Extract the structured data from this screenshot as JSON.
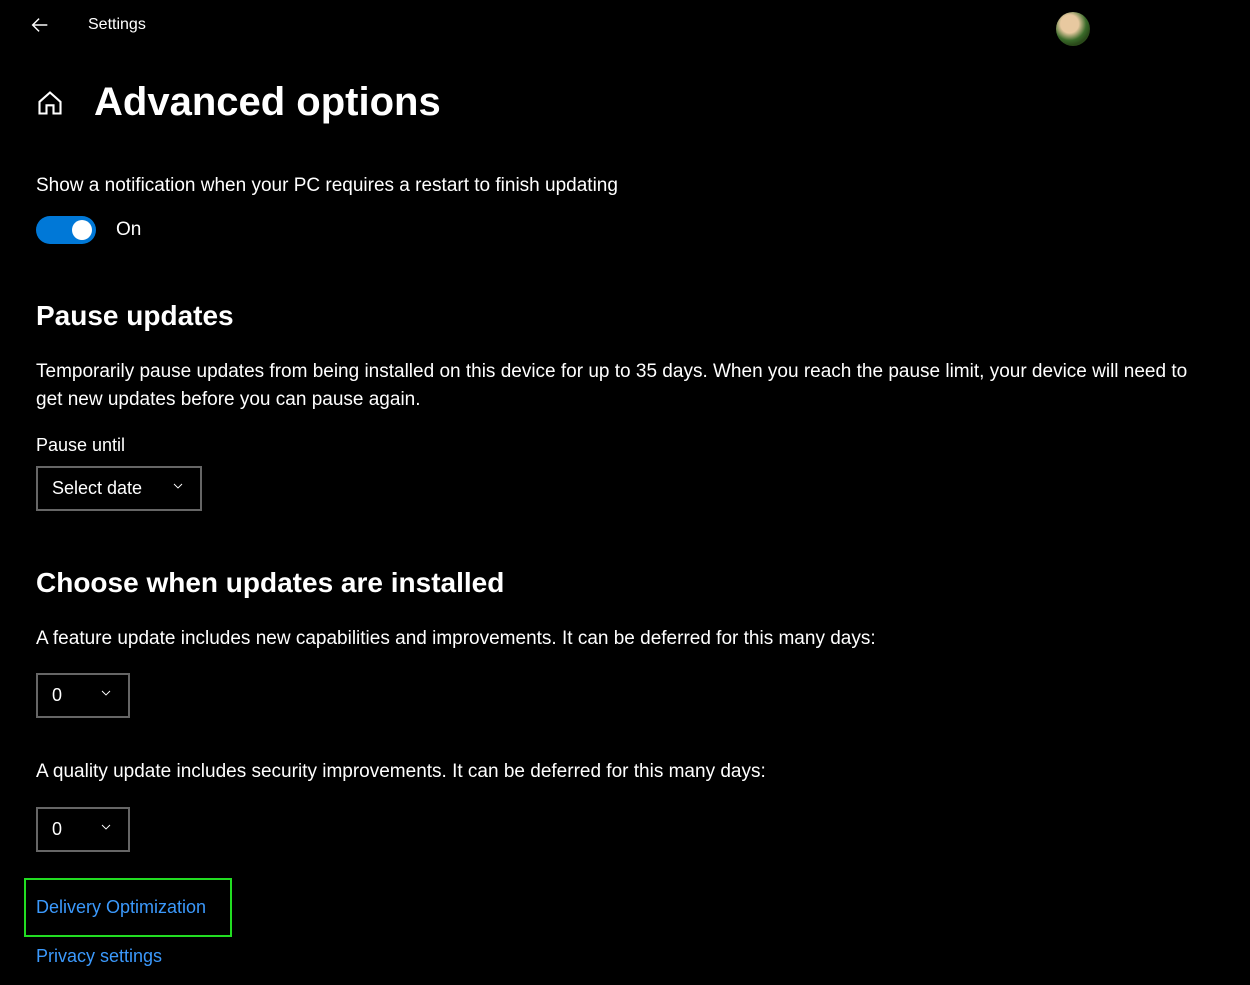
{
  "titlebar": {
    "app_name": "Settings"
  },
  "page": {
    "title": "Advanced options"
  },
  "notification": {
    "label": "Show a notification when your PC requires a restart to finish updating",
    "toggle_state": "On"
  },
  "pause": {
    "heading": "Pause updates",
    "description": "Temporarily pause updates from being installed on this device for up to 35 days. When you reach the pause limit, your device will need to get new updates before you can pause again.",
    "field_label": "Pause until",
    "dropdown_value": "Select date"
  },
  "choose": {
    "heading": "Choose when updates are installed",
    "feature_label": "A feature update includes new capabilities and improvements. It can be deferred for this many days:",
    "feature_value": "0",
    "quality_label": "A quality update includes security improvements. It can be deferred for this many days:",
    "quality_value": "0"
  },
  "links": {
    "delivery": "Delivery Optimization",
    "privacy": "Privacy settings"
  }
}
